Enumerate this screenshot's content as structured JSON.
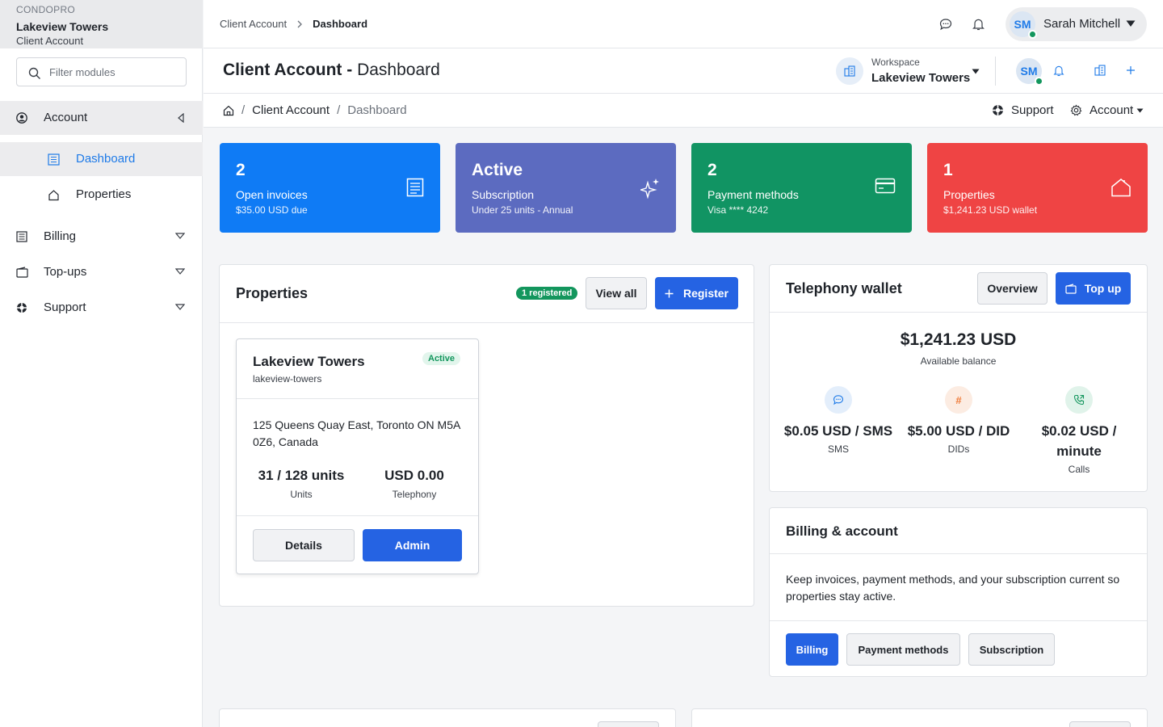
{
  "brand": {
    "kicker": "CONDOPRO",
    "name": "Lakeview Towers",
    "sub": "Client Account"
  },
  "sidebar": {
    "filter_placeholder": "Filter modules",
    "items": [
      {
        "label": "Account",
        "icon": "user-circle-icon"
      },
      {
        "label": "Dashboard",
        "icon": "document-list-icon"
      },
      {
        "label": "Properties",
        "icon": "house-icon"
      },
      {
        "label": "Billing",
        "icon": "ledger-icon"
      },
      {
        "label": "Top-ups",
        "icon": "wallet-icon"
      },
      {
        "label": "Support",
        "icon": "lifebuoy-icon"
      }
    ]
  },
  "topbar": {
    "breadcrumb": [
      "Client Account",
      "Dashboard"
    ],
    "user": {
      "initials": "SM",
      "name": "Sarah Mitchell"
    }
  },
  "page_header": {
    "title_bold": "Client Account -",
    "title_rest": "Dashboard",
    "workspace_label": "Workspace",
    "workspace_value": "Lakeview Towers",
    "avatar_initials": "SM"
  },
  "crumbbar": {
    "items": [
      "Client Account",
      "Dashboard"
    ],
    "separator": "/",
    "support": "Support",
    "account": "Account"
  },
  "stats": [
    {
      "number": "2",
      "label": "Open invoices",
      "sub": "$35.00 USD due",
      "color": "#0f7bf5",
      "icon": "invoice-icon"
    },
    {
      "number": "Active",
      "label": "Subscription",
      "sub": "Under 25 units - Annual",
      "color": "#5c6bc0",
      "icon": "sparkle-icon"
    },
    {
      "number": "2",
      "label": "Payment methods",
      "sub": "Visa **** 4242",
      "color": "#119463",
      "icon": "credit-card-icon"
    },
    {
      "number": "1",
      "label": "Properties",
      "sub": "$1,241.23 USD wallet",
      "color": "#ef4444",
      "icon": "house-icon"
    }
  ],
  "properties_panel": {
    "title": "Properties",
    "badge": "1 registered",
    "view_all": "View all",
    "register": "Register",
    "card": {
      "name": "Lakeview Towers",
      "slug": "lakeview-towers",
      "status": "Active",
      "address": "125 Queens Quay East, Toronto ON M5A 0Z6, Canada",
      "units_value": "31 / 128 units",
      "units_label": "Units",
      "telephony_value": "USD 0.00",
      "telephony_label": "Telephony",
      "details": "Details",
      "admin": "Admin"
    }
  },
  "wallet_panel": {
    "title": "Telephony wallet",
    "overview": "Overview",
    "topup": "Top up",
    "balance": "$1,241.23 USD",
    "balance_label": "Available balance",
    "rates": [
      {
        "value": "$0.05 USD / SMS",
        "label": "SMS",
        "icon": "chat-bubble-icon",
        "color": "#1f7be8"
      },
      {
        "value": "$5.00 USD / DID",
        "label": "DIDs",
        "icon": "hash-icon",
        "color": "#ef7d3c"
      },
      {
        "value": "$0.02 USD / minute",
        "label": "Calls",
        "icon": "phone-icon",
        "color": "#13965d"
      }
    ]
  },
  "billing_panel": {
    "title": "Billing & account",
    "text": "Keep invoices, payment methods, and your subscription current so properties stay active.",
    "buttons": [
      "Billing",
      "Payment methods",
      "Subscription"
    ]
  },
  "colors": {
    "primary": "#2563e3",
    "success": "#13965d",
    "link": "#1f7be8"
  }
}
